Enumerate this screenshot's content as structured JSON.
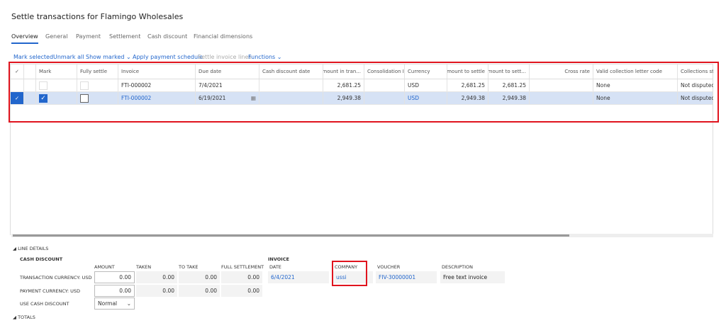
{
  "title": "Settle transactions for Flamingo Wholesales",
  "tabs": [
    "Overview",
    "General",
    "Payment",
    "Settlement",
    "Cash discount",
    "Financial dimensions"
  ],
  "actions": {
    "mark_selected": "Mark selected",
    "unmark_all": "Unmark all",
    "show_marked": "Show marked",
    "apply_schedule": "Apply payment schedule",
    "settle_lines": "Settle invoice lines",
    "functions": "Functions"
  },
  "grid": {
    "headers": [
      "Mark",
      "Fully settle",
      "Invoice",
      "Due date",
      "Cash discount date",
      "Amount in tran...",
      "Consolidation ID",
      "Currency",
      "Amount to settle",
      "Amount to sett...",
      "Cross rate",
      "Valid collection letter code",
      "Collections stat"
    ],
    "rows": [
      {
        "selected": false,
        "mark": false,
        "fully": false,
        "invoice": "FTI-000002",
        "due": "7/4/2021",
        "cdd": "",
        "amount": "2,681.25",
        "cons": "",
        "currency": "USD",
        "settle": "2,681.25",
        "settle2": "2,681.25",
        "cross": "",
        "letter": "None",
        "status": "Not disputed"
      },
      {
        "selected": true,
        "mark": true,
        "fully": false,
        "invoice": "FTI-000002",
        "due": "6/19/2021",
        "cdd": "",
        "amount": "2,949.38",
        "cons": "",
        "currency": "USD",
        "settle": "2,949.38",
        "settle2": "2,949.38",
        "cross": "",
        "letter": "None",
        "status": "Not disputed"
      }
    ]
  },
  "line_details": {
    "header": "LINE DETAILS",
    "cash_discount": "CASH DISCOUNT",
    "cols": [
      "AMOUNT",
      "TAKEN",
      "TO TAKE",
      "FULL SETTLEMENT"
    ],
    "rows": [
      {
        "label": "TRANSACTION CURRENCY: USD",
        "values": [
          "0.00",
          "0.00",
          "0.00",
          "0.00"
        ]
      },
      {
        "label": "PAYMENT CURRENCY: USD",
        "values": [
          "0.00",
          "0.00",
          "0.00",
          "0.00"
        ]
      }
    ],
    "use_cd_label": "USE CASH DISCOUNT",
    "use_cd_value": "Normal",
    "invoice": {
      "header": "INVOICE",
      "date_label": "DATE",
      "date": "6/4/2021",
      "company_label": "COMPANY",
      "company": "ussi",
      "voucher_label": "VOUCHER",
      "voucher": "FIV-30000001",
      "desc_label": "DESCRIPTION",
      "desc": "Free text invoice"
    },
    "totals": "TOTALS"
  }
}
